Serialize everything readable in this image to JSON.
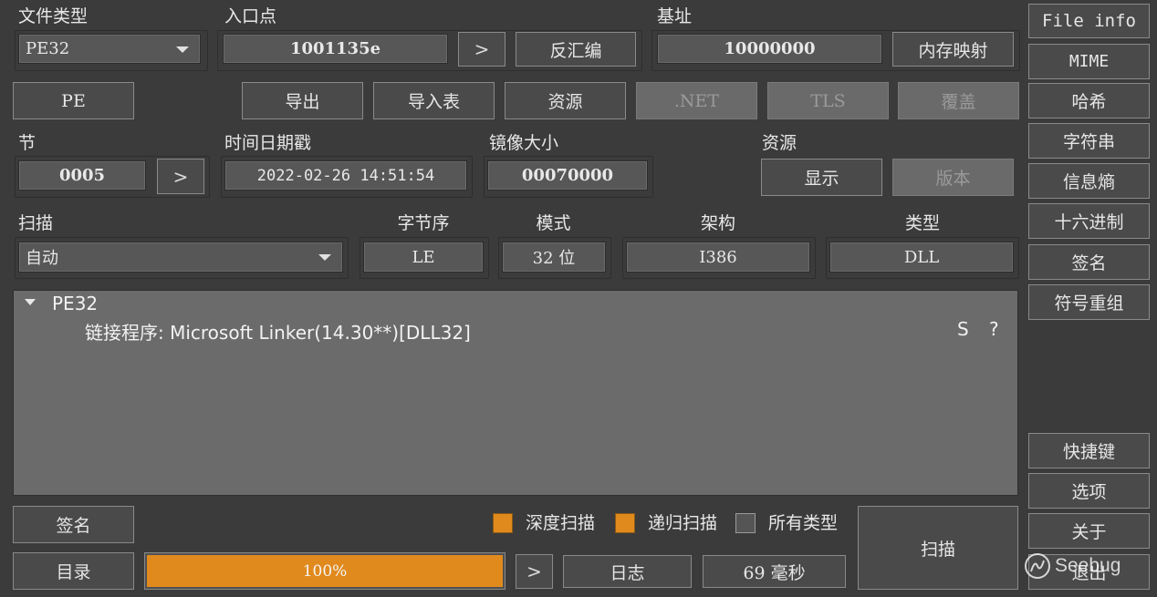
{
  "labels": {
    "file_type": "文件类型",
    "entry_point": "入口点",
    "base_address": "基址",
    "sections": "节",
    "timestamp": "时间日期戳",
    "image_size": "镜像大小",
    "resources": "资源",
    "scan": "扫描",
    "endianness": "字节序",
    "mode": "模式",
    "architecture": "架构",
    "type": "类型"
  },
  "file_type": {
    "value": "PE32"
  },
  "entry_point": {
    "value": "1001135e",
    "goto": ">",
    "disasm": "反汇编"
  },
  "base_address": {
    "value": "10000000",
    "memory_map": "内存映射"
  },
  "toolbar": {
    "pe": "PE",
    "export": "导出",
    "import": "导入表",
    "resources": "资源",
    "net": ".NET",
    "tls": "TLS",
    "overlay": "覆盖"
  },
  "sections": {
    "value": "0005",
    "goto": ">"
  },
  "timestamp": {
    "value": "2022-02-26 14:51:54"
  },
  "image_size": {
    "value": "00070000"
  },
  "resources_group": {
    "show": "显示",
    "version": "版本"
  },
  "scan": {
    "value": "自动"
  },
  "endianness": {
    "value": "LE"
  },
  "mode": {
    "value": "32 位"
  },
  "architecture": {
    "value": "I386"
  },
  "type": {
    "value": "DLL"
  },
  "result": {
    "root": "PE32",
    "entry": "链接程序: Microsoft Linker(14.30**)[DLL32]",
    "flag_s": "S",
    "flag_q": "?"
  },
  "bottom": {
    "signature": "签名",
    "directory": "目录",
    "progress_text": "100%",
    "progress_value": 100,
    "next": ">",
    "log": "日志",
    "elapsed": "69 毫秒",
    "scan_button": "扫描",
    "deep_scan": "深度扫描",
    "recursive_scan": "递归扫描",
    "all_types": "所有类型",
    "deep_scan_checked": true,
    "recursive_scan_checked": true,
    "all_types_checked": false
  },
  "sidebar": {
    "file_info": "File info",
    "mime": "MIME",
    "hash": "哈希",
    "strings": "字符串",
    "entropy": "信息熵",
    "hex": "十六进制",
    "signatures": "签名",
    "demangle": "符号重组",
    "shortcuts": "快捷键",
    "options": "选项",
    "about": "关于",
    "exit": "退出"
  },
  "watermark": {
    "text": "Seebug"
  },
  "colors": {
    "accent": "#e08a1e",
    "background": "#3b3b3b",
    "panel": "#6b6b6b"
  }
}
